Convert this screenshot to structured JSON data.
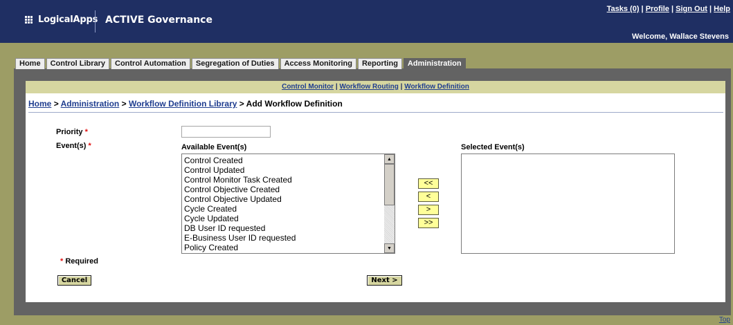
{
  "header": {
    "logo_text": "LogicalApps",
    "product_name": "ACTIVE Governance",
    "links": {
      "tasks": "Tasks (0)",
      "profile": "Profile",
      "sign_out": "Sign Out",
      "help": "Help",
      "separator": "|"
    },
    "welcome": "Welcome, Wallace Stevens"
  },
  "tabs": [
    {
      "label": "Home"
    },
    {
      "label": "Control Library"
    },
    {
      "label": "Control Automation"
    },
    {
      "label": "Segregation of Duties"
    },
    {
      "label": "Access Monitoring"
    },
    {
      "label": "Reporting"
    },
    {
      "label": "Administration",
      "active": true
    }
  ],
  "subnav": {
    "items": [
      "Control Monitor",
      "Workflow Routing",
      "Workflow Definition"
    ],
    "separator": "|"
  },
  "breadcrumb": {
    "items": [
      "Home",
      "Administration",
      "Workflow Definition Library"
    ],
    "separator": ">",
    "current": "Add Workflow Definition"
  },
  "form": {
    "priority_label": "Priority",
    "priority_value": "",
    "events_label": "Event(s)",
    "required_marker": "*",
    "available_label": "Available Event(s)",
    "selected_label": "Selected Event(s)",
    "available_events": [
      "Control Created",
      "Control Updated",
      "Control Monitor Task Created",
      "Control Objective Created",
      "Control Objective Updated",
      "Cycle Created",
      "Cycle Updated",
      "DB User ID requested",
      "E-Business User ID requested",
      "Policy Created"
    ],
    "selected_events": [],
    "move_buttons": {
      "add_all": "<<",
      "add": "<",
      "remove": ">",
      "remove_all": ">>"
    },
    "required_note": "Required"
  },
  "buttons": {
    "cancel": "Cancel",
    "next": "Next >"
  },
  "footer": {
    "top_link": "Top"
  },
  "colors": {
    "header_bg": "#1f2f63",
    "band_bg": "#9d9d65",
    "frame_bg": "#636363",
    "subnav_bg": "#d6d6a0",
    "required": "#e01010",
    "link": "#1f3d8f"
  }
}
